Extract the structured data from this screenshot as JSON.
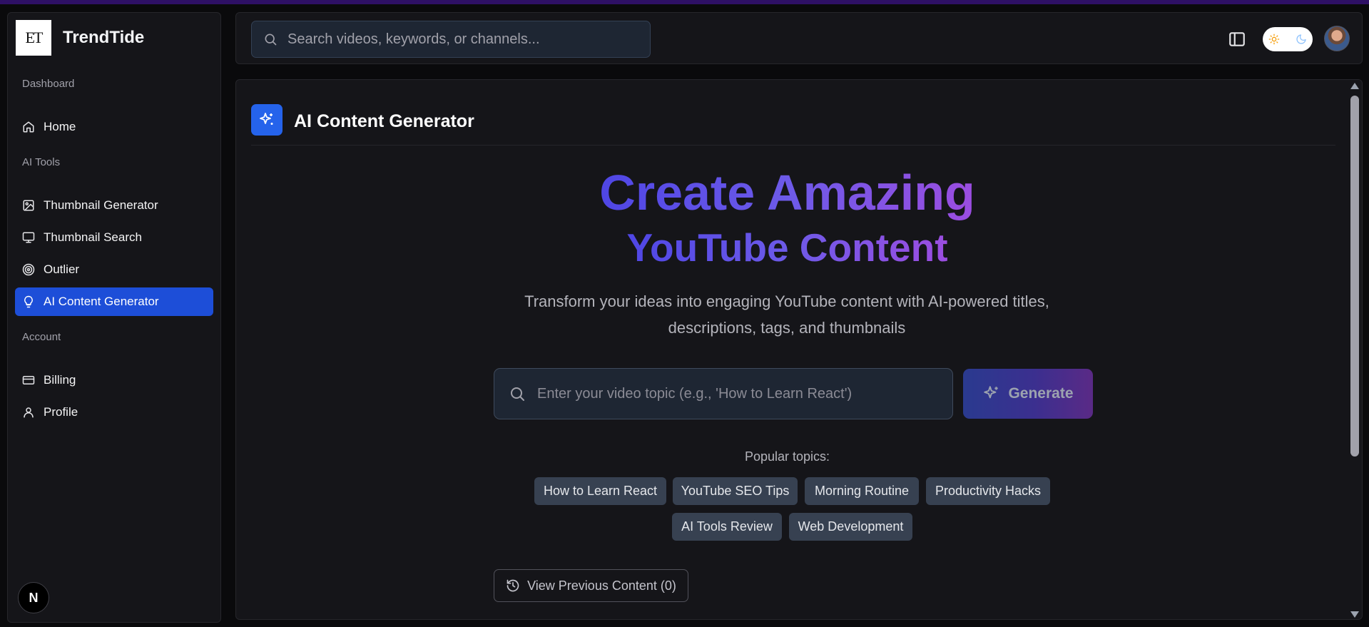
{
  "colors": {
    "accent": "#1d4ed8",
    "header_icon_bg": "#2563eb",
    "gradient_start": "#4f46e5",
    "gradient_end": "#9b4de0",
    "chip_bg": "#374151"
  },
  "sidebar": {
    "brand_logo": "ET",
    "brand_name": "TrendTide",
    "sections": [
      {
        "label": "Dashboard",
        "items": [
          {
            "label": "Home",
            "icon": "home-icon"
          }
        ]
      },
      {
        "label": "AI Tools",
        "items": [
          {
            "label": "Thumbnail Generator",
            "icon": "image-icon"
          },
          {
            "label": "Thumbnail Search",
            "icon": "monitor-icon"
          },
          {
            "label": "Outlier",
            "icon": "target-icon"
          },
          {
            "label": "AI Content Generator",
            "icon": "lightbulb-icon",
            "active": true
          }
        ]
      },
      {
        "label": "Account",
        "items": [
          {
            "label": "Billing",
            "icon": "credit-card-icon"
          },
          {
            "label": "Profile",
            "icon": "user-icon"
          }
        ]
      }
    ],
    "footer_badge": "N"
  },
  "header": {
    "search_placeholder": "Search videos, keywords, or channels...",
    "icons": [
      "search-icon",
      "sidebar-panel-icon",
      "sun-icon",
      "moon-icon"
    ]
  },
  "main": {
    "page_title": "AI Content Generator",
    "hero_line1": "Create Amazing",
    "hero_line2": "YouTube Content",
    "subtitle": "Transform your ideas into engaging YouTube content with AI-powered titles, descriptions, tags, and thumbnails",
    "topic_placeholder": "Enter your video topic (e.g., 'How to Learn React')",
    "generate_label": "Generate",
    "popular_label": "Popular topics:",
    "topics": [
      "How to Learn React",
      "YouTube SEO Tips",
      "Morning Routine",
      "Productivity Hacks",
      "AI Tools Review",
      "Web Development"
    ],
    "history_label": "View Previous Content (0)"
  }
}
